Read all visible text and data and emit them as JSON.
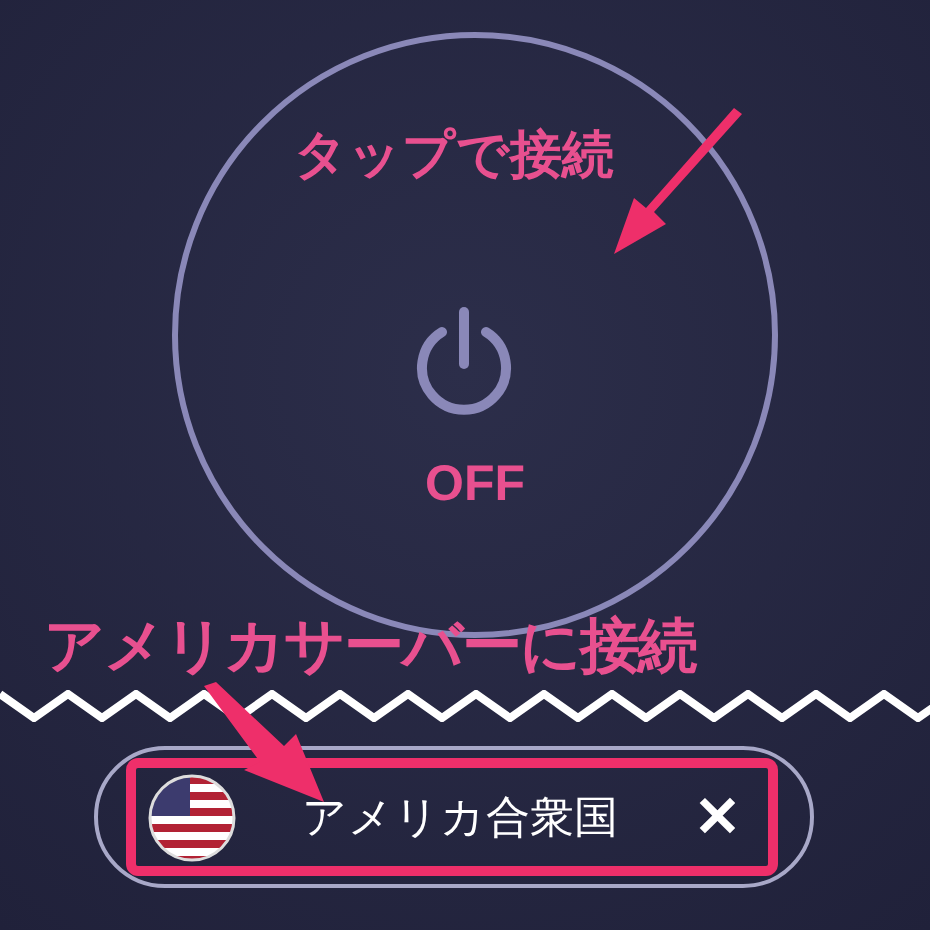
{
  "power_button": {
    "label": "OFF"
  },
  "server": {
    "name": "アメリカ合衆国",
    "close": "✕"
  },
  "annotations": [
    {
      "text": "タップで接続"
    },
    {
      "text": "アメリカサーバーに接続"
    }
  ]
}
